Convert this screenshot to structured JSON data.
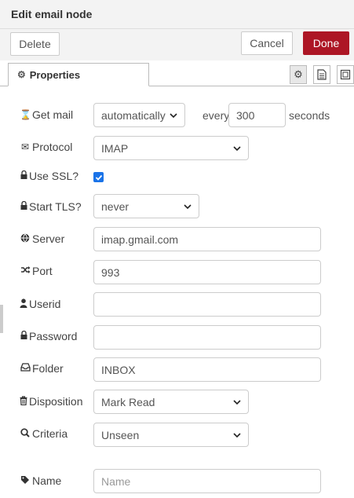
{
  "header": {
    "title": "Edit email node"
  },
  "toolbar": {
    "delete_label": "Delete",
    "cancel_label": "Cancel",
    "done_label": "Done"
  },
  "tabs": {
    "properties_label": "Properties"
  },
  "colors": {
    "done": "#ad1625",
    "checkbox": "#1a73e8"
  },
  "form": {
    "getmail": {
      "label": "Get mail",
      "value": "automatically",
      "every_label": "every",
      "interval": "300",
      "unit": "seconds"
    },
    "protocol": {
      "label": "Protocol",
      "value": "IMAP"
    },
    "ssl": {
      "label": "Use SSL?",
      "checked": true
    },
    "tls": {
      "label": "Start TLS?",
      "value": "never"
    },
    "server": {
      "label": "Server",
      "value": "imap.gmail.com"
    },
    "port": {
      "label": "Port",
      "value": "993"
    },
    "userid": {
      "label": "Userid",
      "value": ""
    },
    "password": {
      "label": "Password",
      "value": ""
    },
    "folder": {
      "label": "Folder",
      "value": "INBOX"
    },
    "disposition": {
      "label": "Disposition",
      "value": "Mark Read"
    },
    "criteria": {
      "label": "Criteria",
      "value": "Unseen"
    },
    "name": {
      "label": "Name",
      "value": "",
      "placeholder": "Name"
    }
  }
}
